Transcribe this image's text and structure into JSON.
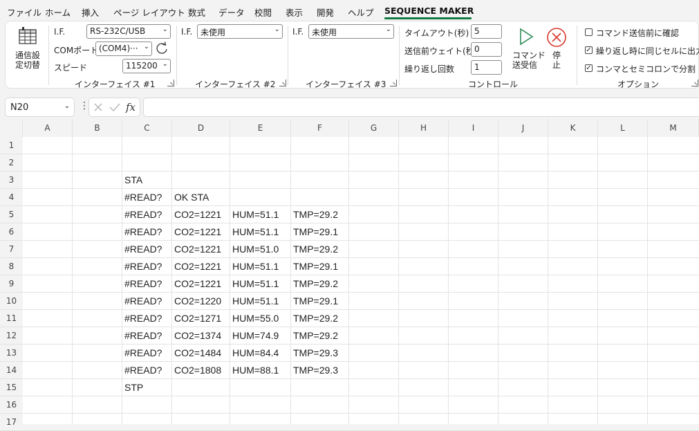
{
  "menu": [
    {
      "label": "ファイル"
    },
    {
      "label": "ホーム"
    },
    {
      "label": "挿入"
    },
    {
      "label": "ページ レイアウト"
    },
    {
      "label": "数式"
    },
    {
      "label": "データ"
    },
    {
      "label": "校閲"
    },
    {
      "label": "表示"
    },
    {
      "label": "開発"
    },
    {
      "label": "ヘルプ"
    },
    {
      "label": "SEQUENCE MAKER"
    }
  ],
  "ribbon": {
    "switch_label_1": "通信設",
    "switch_label_2": "定切替",
    "if1": {
      "if_label": "I.F.",
      "if_value": "RS-232C/USB",
      "com_label": "COMポート",
      "com_value": "(COM4)···",
      "speed_label": "スピード",
      "speed_value": "115200",
      "group_label": "インターフェイス #1"
    },
    "if2": {
      "if_label": "I.F.",
      "if_value": "未使用",
      "group_label": "インターフェイス #2"
    },
    "if3": {
      "if_label": "I.F.",
      "if_value": "未使用",
      "group_label": "インターフェイス #3"
    },
    "control": {
      "timeout_label": "タイムアウト(秒)",
      "timeout_value": "5",
      "wait_label": "送信前ウェイト(秒)",
      "wait_value": "0",
      "repeat_label": "繰り返し回数",
      "repeat_value": "1",
      "send_label_1": "コマンド",
      "send_label_2": "送受信",
      "stop_label_1": "停",
      "stop_label_2": "止",
      "group_label": "コントロール"
    },
    "options": {
      "confirm_label": "コマンド送信前に確認",
      "confirm_checked": false,
      "same_cell_label": "繰り返し時に同じセルに出力",
      "same_cell_checked": true,
      "split_label": "コンマとセミコロンで分割",
      "split_checked": true,
      "group_label": "オプション"
    }
  },
  "formula_bar": {
    "name_box": "N20",
    "formula": ""
  },
  "columns": [
    "A",
    "B",
    "C",
    "D",
    "E",
    "F",
    "G",
    "H",
    "I",
    "J",
    "K",
    "L",
    "M"
  ],
  "rows": [
    {
      "n": "1",
      "C": "",
      "D": "",
      "E": "",
      "F": ""
    },
    {
      "n": "2",
      "C": "",
      "D": "",
      "E": "",
      "F": ""
    },
    {
      "n": "3",
      "C": "STA",
      "D": "",
      "E": "",
      "F": ""
    },
    {
      "n": "4",
      "C": "#READ?",
      "D": "OK STA",
      "E": "",
      "F": ""
    },
    {
      "n": "5",
      "C": "#READ?",
      "D": "CO2=1221",
      "E": "HUM=51.1",
      "F": "TMP=29.2"
    },
    {
      "n": "6",
      "C": "#READ?",
      "D": "CO2=1221",
      "E": "HUM=51.1",
      "F": "TMP=29.1"
    },
    {
      "n": "7",
      "C": "#READ?",
      "D": "CO2=1221",
      "E": "HUM=51.0",
      "F": "TMP=29.2"
    },
    {
      "n": "8",
      "C": "#READ?",
      "D": "CO2=1221",
      "E": "HUM=51.1",
      "F": "TMP=29.1"
    },
    {
      "n": "9",
      "C": "#READ?",
      "D": "CO2=1221",
      "E": "HUM=51.1",
      "F": "TMP=29.2"
    },
    {
      "n": "10",
      "C": "#READ?",
      "D": "CO2=1220",
      "E": "HUM=51.1",
      "F": "TMP=29.1"
    },
    {
      "n": "11",
      "C": "#READ?",
      "D": "CO2=1271",
      "E": "HUM=55.0",
      "F": "TMP=29.2"
    },
    {
      "n": "12",
      "C": "#READ?",
      "D": "CO2=1374",
      "E": "HUM=74.9",
      "F": "TMP=29.2"
    },
    {
      "n": "13",
      "C": "#READ?",
      "D": "CO2=1484",
      "E": "HUM=84.4",
      "F": "TMP=29.3"
    },
    {
      "n": "14",
      "C": "#READ?",
      "D": "CO2=1808",
      "E": "HUM=88.1",
      "F": "TMP=29.3"
    },
    {
      "n": "15",
      "C": "STP",
      "D": "",
      "E": "",
      "F": ""
    },
    {
      "n": "16",
      "C": "",
      "D": "",
      "E": "",
      "F": ""
    },
    {
      "n": "17",
      "C": "",
      "D": "",
      "E": "",
      "F": ""
    }
  ],
  "colors": {
    "accent": "#107c41",
    "play": "#2e8b57",
    "stop": "#d9342b"
  }
}
